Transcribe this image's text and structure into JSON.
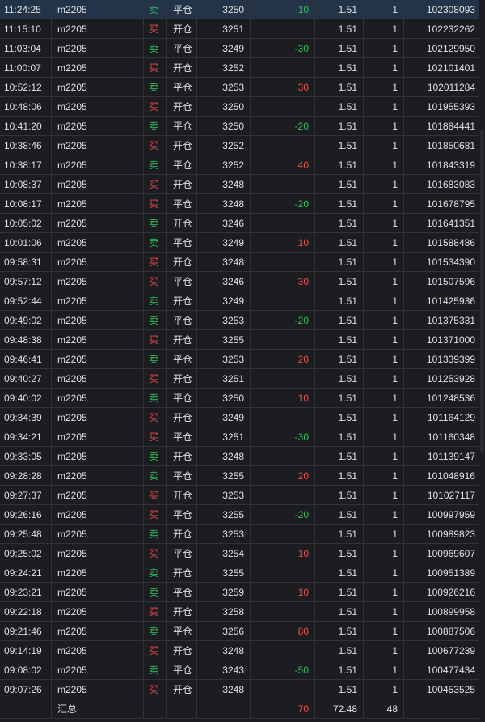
{
  "colors": {
    "buy": "#f24b4b",
    "sell": "#2dc05a",
    "background": "#1c1d21",
    "selected_row": "#243448"
  },
  "rows": [
    {
      "time": "11:24:25",
      "code": "m2205",
      "dir": "卖",
      "offset": "平仓",
      "price": "3250",
      "pnl": "-10",
      "fee": "1.51",
      "vol": "1",
      "id": "102308093"
    },
    {
      "time": "11:15:10",
      "code": "m2205",
      "dir": "买",
      "offset": "开仓",
      "price": "3251",
      "pnl": "",
      "fee": "1.51",
      "vol": "1",
      "id": "102232262"
    },
    {
      "time": "11:03:04",
      "code": "m2205",
      "dir": "卖",
      "offset": "平仓",
      "price": "3249",
      "pnl": "-30",
      "fee": "1.51",
      "vol": "1",
      "id": "102129950"
    },
    {
      "time": "11:00:07",
      "code": "m2205",
      "dir": "买",
      "offset": "开仓",
      "price": "3252",
      "pnl": "",
      "fee": "1.51",
      "vol": "1",
      "id": "102101401"
    },
    {
      "time": "10:52:12",
      "code": "m2205",
      "dir": "卖",
      "offset": "平仓",
      "price": "3253",
      "pnl": "30",
      "fee": "1.51",
      "vol": "1",
      "id": "102011284"
    },
    {
      "time": "10:48:06",
      "code": "m2205",
      "dir": "买",
      "offset": "开仓",
      "price": "3250",
      "pnl": "",
      "fee": "1.51",
      "vol": "1",
      "id": "101955393"
    },
    {
      "time": "10:41:20",
      "code": "m2205",
      "dir": "卖",
      "offset": "平仓",
      "price": "3250",
      "pnl": "-20",
      "fee": "1.51",
      "vol": "1",
      "id": "101884441"
    },
    {
      "time": "10:38:46",
      "code": "m2205",
      "dir": "买",
      "offset": "开仓",
      "price": "3252",
      "pnl": "",
      "fee": "1.51",
      "vol": "1",
      "id": "101850681"
    },
    {
      "time": "10:38:17",
      "code": "m2205",
      "dir": "卖",
      "offset": "平仓",
      "price": "3252",
      "pnl": "40",
      "fee": "1.51",
      "vol": "1",
      "id": "101843319"
    },
    {
      "time": "10:08:37",
      "code": "m2205",
      "dir": "买",
      "offset": "开仓",
      "price": "3248",
      "pnl": "",
      "fee": "1.51",
      "vol": "1",
      "id": "101683083"
    },
    {
      "time": "10:08:17",
      "code": "m2205",
      "dir": "买",
      "offset": "平仓",
      "price": "3248",
      "pnl": "-20",
      "fee": "1.51",
      "vol": "1",
      "id": "101678795"
    },
    {
      "time": "10:05:02",
      "code": "m2205",
      "dir": "卖",
      "offset": "开仓",
      "price": "3246",
      "pnl": "",
      "fee": "1.51",
      "vol": "1",
      "id": "101641351"
    },
    {
      "time": "10:01:06",
      "code": "m2205",
      "dir": "卖",
      "offset": "平仓",
      "price": "3249",
      "pnl": "10",
      "fee": "1.51",
      "vol": "1",
      "id": "101588486"
    },
    {
      "time": "09:58:31",
      "code": "m2205",
      "dir": "买",
      "offset": "开仓",
      "price": "3248",
      "pnl": "",
      "fee": "1.51",
      "vol": "1",
      "id": "101534390"
    },
    {
      "time": "09:57:12",
      "code": "m2205",
      "dir": "买",
      "offset": "平仓",
      "price": "3246",
      "pnl": "30",
      "fee": "1.51",
      "vol": "1",
      "id": "101507596"
    },
    {
      "time": "09:52:44",
      "code": "m2205",
      "dir": "卖",
      "offset": "开仓",
      "price": "3249",
      "pnl": "",
      "fee": "1.51",
      "vol": "1",
      "id": "101425936"
    },
    {
      "time": "09:49:02",
      "code": "m2205",
      "dir": "卖",
      "offset": "平仓",
      "price": "3253",
      "pnl": "-20",
      "fee": "1.51",
      "vol": "1",
      "id": "101375331"
    },
    {
      "time": "09:48:38",
      "code": "m2205",
      "dir": "买",
      "offset": "开仓",
      "price": "3255",
      "pnl": "",
      "fee": "1.51",
      "vol": "1",
      "id": "101371000"
    },
    {
      "time": "09:46:41",
      "code": "m2205",
      "dir": "卖",
      "offset": "平仓",
      "price": "3253",
      "pnl": "20",
      "fee": "1.51",
      "vol": "1",
      "id": "101339399"
    },
    {
      "time": "09:40:27",
      "code": "m2205",
      "dir": "买",
      "offset": "开仓",
      "price": "3251",
      "pnl": "",
      "fee": "1.51",
      "vol": "1",
      "id": "101253928"
    },
    {
      "time": "09:40:02",
      "code": "m2205",
      "dir": "卖",
      "offset": "平仓",
      "price": "3250",
      "pnl": "10",
      "fee": "1.51",
      "vol": "1",
      "id": "101248536"
    },
    {
      "time": "09:34:39",
      "code": "m2205",
      "dir": "买",
      "offset": "开仓",
      "price": "3249",
      "pnl": "",
      "fee": "1.51",
      "vol": "1",
      "id": "101164129"
    },
    {
      "time": "09:34:21",
      "code": "m2205",
      "dir": "买",
      "offset": "平仓",
      "price": "3251",
      "pnl": "-30",
      "fee": "1.51",
      "vol": "1",
      "id": "101160348"
    },
    {
      "time": "09:33:05",
      "code": "m2205",
      "dir": "卖",
      "offset": "开仓",
      "price": "3248",
      "pnl": "",
      "fee": "1.51",
      "vol": "1",
      "id": "101139147"
    },
    {
      "time": "09:28:28",
      "code": "m2205",
      "dir": "卖",
      "offset": "平仓",
      "price": "3255",
      "pnl": "20",
      "fee": "1.51",
      "vol": "1",
      "id": "101048916"
    },
    {
      "time": "09:27:37",
      "code": "m2205",
      "dir": "买",
      "offset": "开仓",
      "price": "3253",
      "pnl": "",
      "fee": "1.51",
      "vol": "1",
      "id": "101027117"
    },
    {
      "time": "09:26:16",
      "code": "m2205",
      "dir": "买",
      "offset": "平仓",
      "price": "3255",
      "pnl": "-20",
      "fee": "1.51",
      "vol": "1",
      "id": "100997959"
    },
    {
      "time": "09:25:48",
      "code": "m2205",
      "dir": "卖",
      "offset": "开仓",
      "price": "3253",
      "pnl": "",
      "fee": "1.51",
      "vol": "1",
      "id": "100989823"
    },
    {
      "time": "09:25:02",
      "code": "m2205",
      "dir": "买",
      "offset": "平仓",
      "price": "3254",
      "pnl": "10",
      "fee": "1.51",
      "vol": "1",
      "id": "100969607"
    },
    {
      "time": "09:24:21",
      "code": "m2205",
      "dir": "卖",
      "offset": "开仓",
      "price": "3255",
      "pnl": "",
      "fee": "1.51",
      "vol": "1",
      "id": "100951389"
    },
    {
      "time": "09:23:21",
      "code": "m2205",
      "dir": "卖",
      "offset": "平仓",
      "price": "3259",
      "pnl": "10",
      "fee": "1.51",
      "vol": "1",
      "id": "100926216"
    },
    {
      "time": "09:22:18",
      "code": "m2205",
      "dir": "买",
      "offset": "开仓",
      "price": "3258",
      "pnl": "",
      "fee": "1.51",
      "vol": "1",
      "id": "100899958"
    },
    {
      "time": "09:21:46",
      "code": "m2205",
      "dir": "卖",
      "offset": "平仓",
      "price": "3256",
      "pnl": "80",
      "fee": "1.51",
      "vol": "1",
      "id": "100887506"
    },
    {
      "time": "09:14:19",
      "code": "m2205",
      "dir": "买",
      "offset": "开仓",
      "price": "3248",
      "pnl": "",
      "fee": "1.51",
      "vol": "1",
      "id": "100677239"
    },
    {
      "time": "09:08:02",
      "code": "m2205",
      "dir": "卖",
      "offset": "平仓",
      "price": "3243",
      "pnl": "-50",
      "fee": "1.51",
      "vol": "1",
      "id": "100477434"
    },
    {
      "time": "09:07:26",
      "code": "m2205",
      "dir": "买",
      "offset": "开仓",
      "price": "3248",
      "pnl": "",
      "fee": "1.51",
      "vol": "1",
      "id": "100453525"
    }
  ],
  "summary": {
    "label": "汇总",
    "pnl": "70",
    "fee": "72.48",
    "vol": "48"
  }
}
